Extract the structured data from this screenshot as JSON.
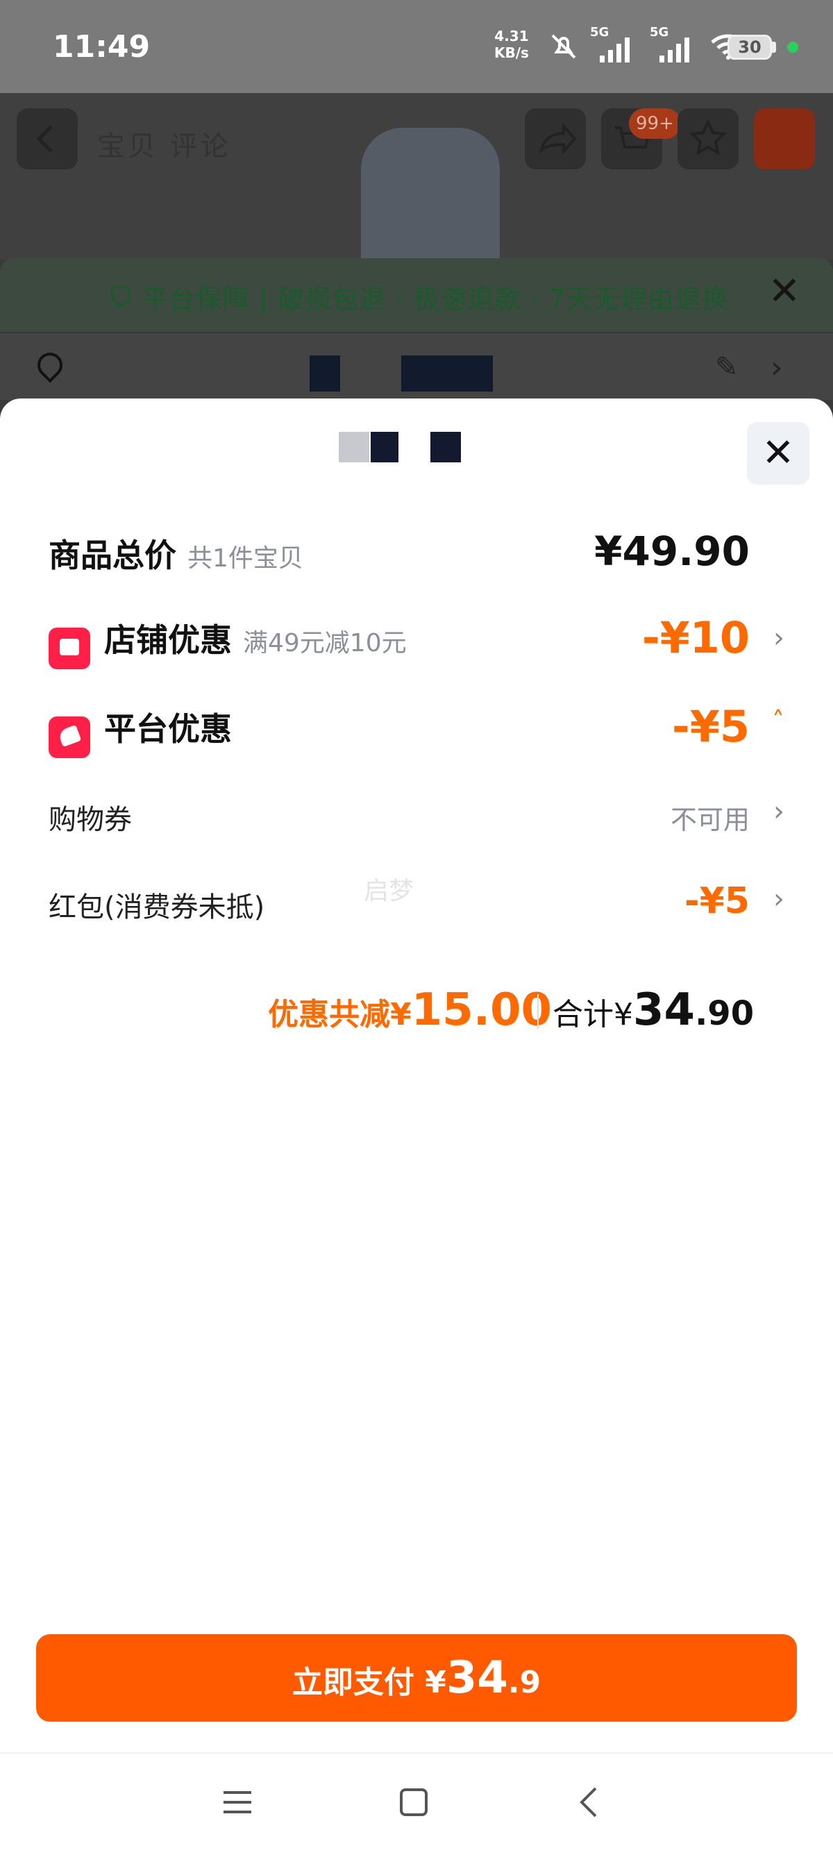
{
  "status_bar": {
    "time": "11:49",
    "speed_value": "4.31",
    "speed_unit": "KB/s",
    "signal1": "5G",
    "signal2": "5G",
    "battery": "30"
  },
  "background_page": {
    "title": "宝贝 评论",
    "cart_badge": "99+",
    "guarantee_text": "平台保障 | 破损包退 · 极速退款 · 7天无理由退换"
  },
  "sheet": {
    "rows": {
      "total_price": {
        "label": "商品总价",
        "sub": "共1件宝贝",
        "value": "¥49.90"
      },
      "store_discount": {
        "label": "店铺优惠",
        "sub": "满49元减10元",
        "value": "-¥10"
      },
      "platform_discount": {
        "label": "平台优惠",
        "value": "-¥5"
      },
      "shopping_coupon": {
        "label": "购物券",
        "value": "不可用"
      },
      "red_packet": {
        "label": "红包(消费券未抵)",
        "value": "-¥5"
      }
    },
    "watermark": "启梦",
    "summary": {
      "discount_label": "优惠共减¥",
      "discount_value": "15.00",
      "total_label": "合计¥",
      "total_int": "34",
      "total_dec": ".90"
    },
    "pay_button": {
      "label": "立即支付 ¥",
      "amount_int": "34",
      "amount_dec": ".9"
    }
  },
  "colors": {
    "accent": "#ff6a00",
    "pay_button": "#ff5a00",
    "tag_icon": "#ff1f47"
  },
  "icons": [
    "back-icon",
    "share-icon",
    "cart-icon",
    "star-icon",
    "shield-icon",
    "close-icon",
    "location-pin-icon",
    "edit-icon",
    "chevron-right-icon",
    "chevron-up-icon",
    "store-icon",
    "tag-icon",
    "menu-icon",
    "home-icon",
    "back-nav-icon"
  ]
}
